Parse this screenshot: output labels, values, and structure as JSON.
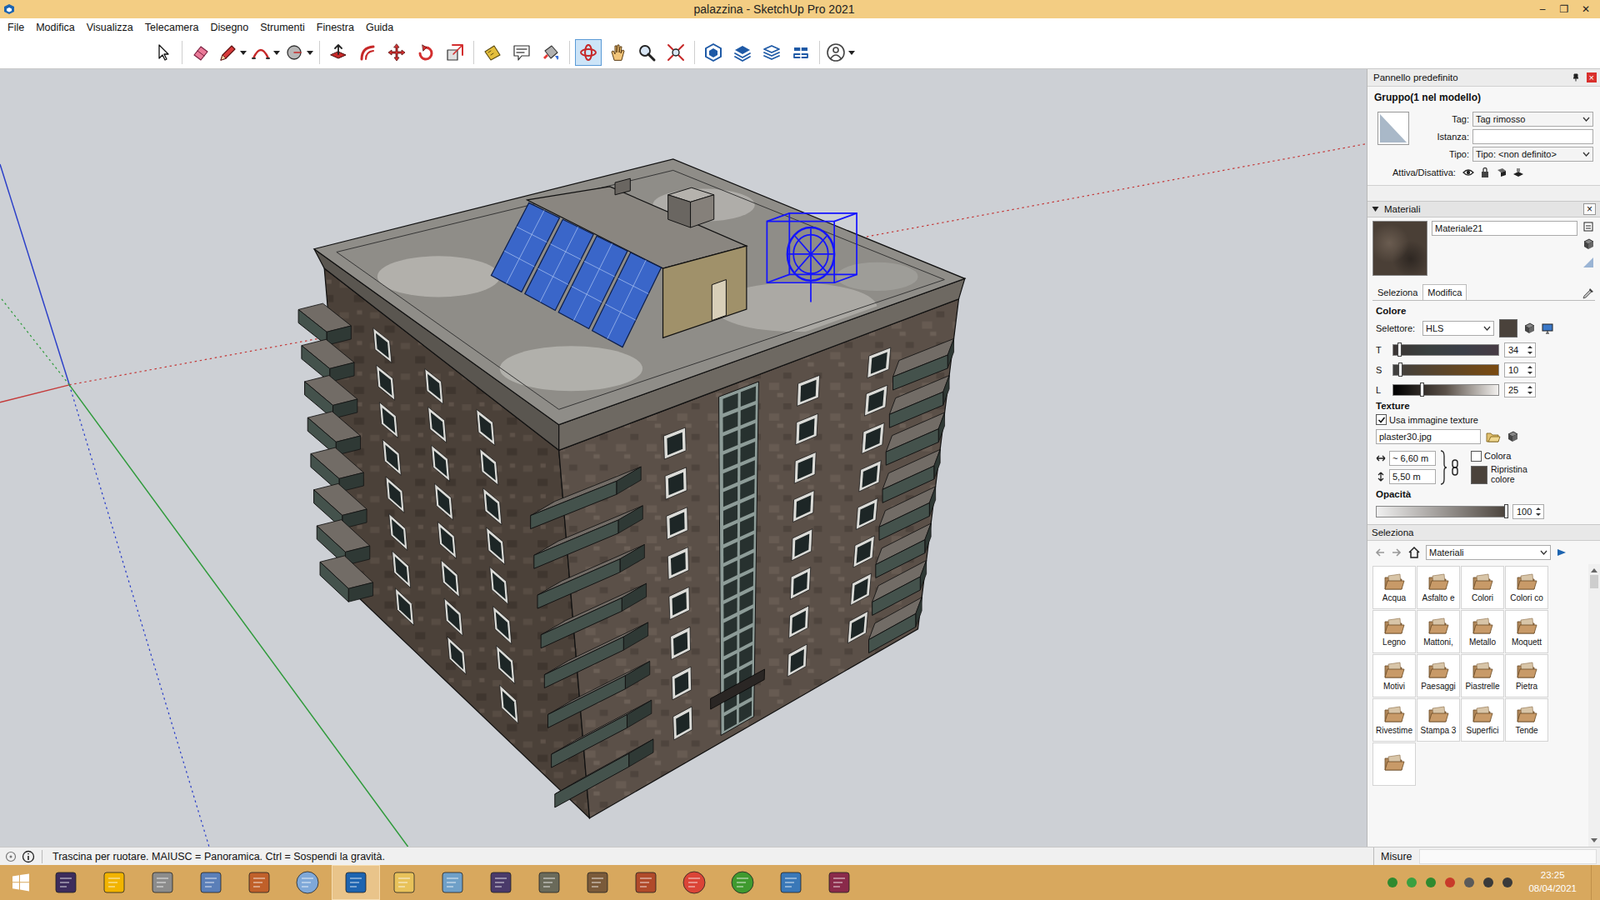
{
  "window": {
    "title": "palazzina - SketchUp Pro 2021",
    "controls": [
      "–",
      "❐",
      "✕"
    ]
  },
  "menu": [
    "File",
    "Modifica",
    "Visualizza",
    "Telecamera",
    "Disegno",
    "Strumenti",
    "Finestra",
    "Guida"
  ],
  "toolbar": [
    [
      {
        "icon": "select",
        "selected": false,
        "dropdown": false
      }
    ],
    [
      {
        "icon": "eraser",
        "selected": false,
        "dropdown": false
      },
      {
        "icon": "line",
        "selected": false,
        "dropdown": true
      },
      {
        "icon": "arc",
        "selected": false,
        "dropdown": true
      },
      {
        "icon": "shape",
        "selected": false,
        "dropdown": true
      }
    ],
    [
      {
        "icon": "push-pull",
        "selected": false,
        "dropdown": false
      },
      {
        "icon": "offset",
        "selected": false,
        "dropdown": false
      },
      {
        "icon": "move",
        "selected": false,
        "dropdown": false
      },
      {
        "icon": "rotate",
        "selected": false,
        "dropdown": false
      },
      {
        "icon": "scale",
        "selected": false,
        "dropdown": false
      }
    ],
    [
      {
        "icon": "tape",
        "selected": false,
        "dropdown": false
      },
      {
        "icon": "text",
        "selected": false,
        "dropdown": false
      },
      {
        "icon": "paint",
        "selected": false,
        "dropdown": false
      }
    ],
    [
      {
        "icon": "orbit",
        "selected": true,
        "dropdown": false
      },
      {
        "icon": "pan",
        "selected": false,
        "dropdown": false
      },
      {
        "icon": "zoom",
        "selected": false,
        "dropdown": false
      },
      {
        "icon": "zoom-extents",
        "selected": false,
        "dropdown": false
      }
    ],
    [
      {
        "icon": "warehouse",
        "selected": false,
        "dropdown": false
      },
      {
        "icon": "extension-warehouse",
        "selected": false,
        "dropdown": false
      },
      {
        "icon": "layout",
        "selected": false,
        "dropdown": false
      },
      {
        "icon": "extension-manager",
        "selected": false,
        "dropdown": false
      }
    ],
    [
      {
        "icon": "profile",
        "selected": false,
        "dropdown": true
      }
    ]
  ],
  "panel": {
    "title": "Pannello predefinito",
    "close": "×",
    "entity": {
      "heading": "Gruppo(1 nel modello)",
      "fields": [
        {
          "label": "Tag:",
          "value": "Tag rimosso",
          "kind": "dropdown"
        },
        {
          "label": "Istanza:",
          "value": "",
          "kind": "input"
        },
        {
          "label": "Tipo:",
          "value": "Tipo: <non definito>",
          "kind": "dropdown"
        }
      ],
      "toggles_label": "Attiva/Disattiva:"
    },
    "materials": {
      "title": "Materiali",
      "expanded": true,
      "close": "×",
      "name": "Materiale21",
      "tabs": [
        {
          "label": "Seleziona",
          "selected": false
        },
        {
          "label": "Modifica",
          "selected": true
        }
      ],
      "color_heading": "Colore",
      "picker_label": "Selettore:",
      "picker": "HLS",
      "sliders": [
        {
          "label": "T",
          "value": "34",
          "level": 0.04
        },
        {
          "label": "S",
          "value": "10",
          "level": 0.05
        },
        {
          "label": "L",
          "value": "25",
          "level": 0.25
        }
      ],
      "texture_heading": "Texture",
      "use_texture": {
        "label": "Usa immagine texture",
        "checked": true
      },
      "texture_file": "plaster30.jpg",
      "width": "~ 6,60 m",
      "height": "5,50 m",
      "colorize": {
        "label": "Colora",
        "checked": false
      },
      "reset": "Ripristina colore",
      "opacity_heading": "Opacità",
      "opacity": {
        "value": "100",
        "level": 1
      }
    },
    "browser": {
      "title": "Seleziona",
      "collection": "Materiali",
      "folders": [
        "Acqua",
        "Asfalto e",
        "Colori",
        "Colori co",
        "Legno",
        "Mattoni,",
        "Metallo",
        "Moquett",
        "Motivi",
        "Paesaggi",
        "Piastrelle",
        "Pietra",
        "Rivestime",
        "Stampa 3",
        "Superfici",
        "Tende",
        ""
      ]
    }
  },
  "status_bar": {
    "text": "Trascina per ruotare. MAIUSC = Panoramica. Ctrl = Sospendi la gravità.",
    "measure_label": "Misure",
    "measure_value": ""
  },
  "taskbar": {
    "apps": [
      {
        "app": "simcity",
        "kind": "square",
        "color": "#3d2c5c",
        "active": false
      },
      {
        "app": "vectorworks",
        "kind": "square",
        "color": "#f2b400",
        "active": false
      },
      {
        "app": "printer",
        "kind": "square",
        "color": "#8c8c8c",
        "active": false
      },
      {
        "app": "calculator",
        "kind": "square",
        "color": "#5b7fb8",
        "active": false
      },
      {
        "app": "paint-tool",
        "kind": "square",
        "color": "#c0602a",
        "active": false
      },
      {
        "app": "palette",
        "kind": "circle",
        "color": "#7fa8d8",
        "active": false
      },
      {
        "app": "sketchup",
        "kind": "square",
        "color": "#1d64b0",
        "active": true
      },
      {
        "app": "explorer",
        "kind": "square",
        "color": "#e8c25a",
        "active": false
      },
      {
        "app": "notepad",
        "kind": "square",
        "color": "#6fa0c8",
        "active": false
      },
      {
        "app": "game-one",
        "kind": "square",
        "color": "#4a3a6a",
        "active": false
      },
      {
        "app": "game-two",
        "kind": "square",
        "color": "#6a6a5a",
        "active": false
      },
      {
        "app": "game-three",
        "kind": "square",
        "color": "#7a5a3a",
        "active": false
      },
      {
        "app": "house",
        "kind": "square",
        "color": "#b04a2a",
        "active": false
      },
      {
        "app": "chrome",
        "kind": "circle",
        "color": "#db4437",
        "active": false
      },
      {
        "app": "utorrent",
        "kind": "circle",
        "color": "#3f9a2f",
        "active": false
      },
      {
        "app": "photos",
        "kind": "square",
        "color": "#3a78b8",
        "active": false
      },
      {
        "app": "winrar",
        "kind": "square",
        "color": "#8a2a4a",
        "active": false
      }
    ],
    "time": "23:25",
    "date": "08/04/2021"
  }
}
